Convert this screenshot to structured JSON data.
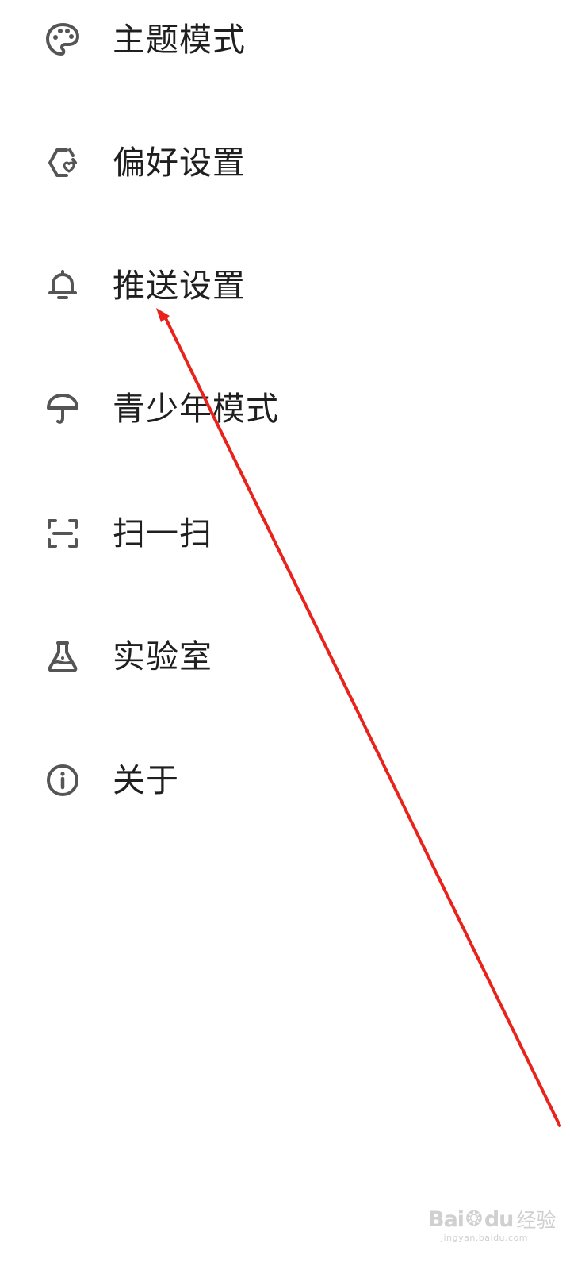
{
  "menu": {
    "items": [
      {
        "label": "主题模式",
        "icon": "palette-icon"
      },
      {
        "label": "偏好设置",
        "icon": "hexagon-heart-icon"
      },
      {
        "label": "推送设置",
        "icon": "bell-icon"
      },
      {
        "label": "青少年模式",
        "icon": "umbrella-icon"
      },
      {
        "label": "扫一扫",
        "icon": "scan-icon"
      },
      {
        "label": "实验室",
        "icon": "flask-icon"
      },
      {
        "label": "关于",
        "icon": "info-icon"
      }
    ]
  },
  "annotation": {
    "arrow_color": "#e8231b"
  },
  "watermark": {
    "logo_text": "Bai",
    "logo_text_2": "du",
    "jingyan": "经验",
    "url": "jingyan.baidu.com"
  },
  "colors": {
    "text": "#1f1f1f",
    "icon": "#555555",
    "background": "#ffffff"
  }
}
